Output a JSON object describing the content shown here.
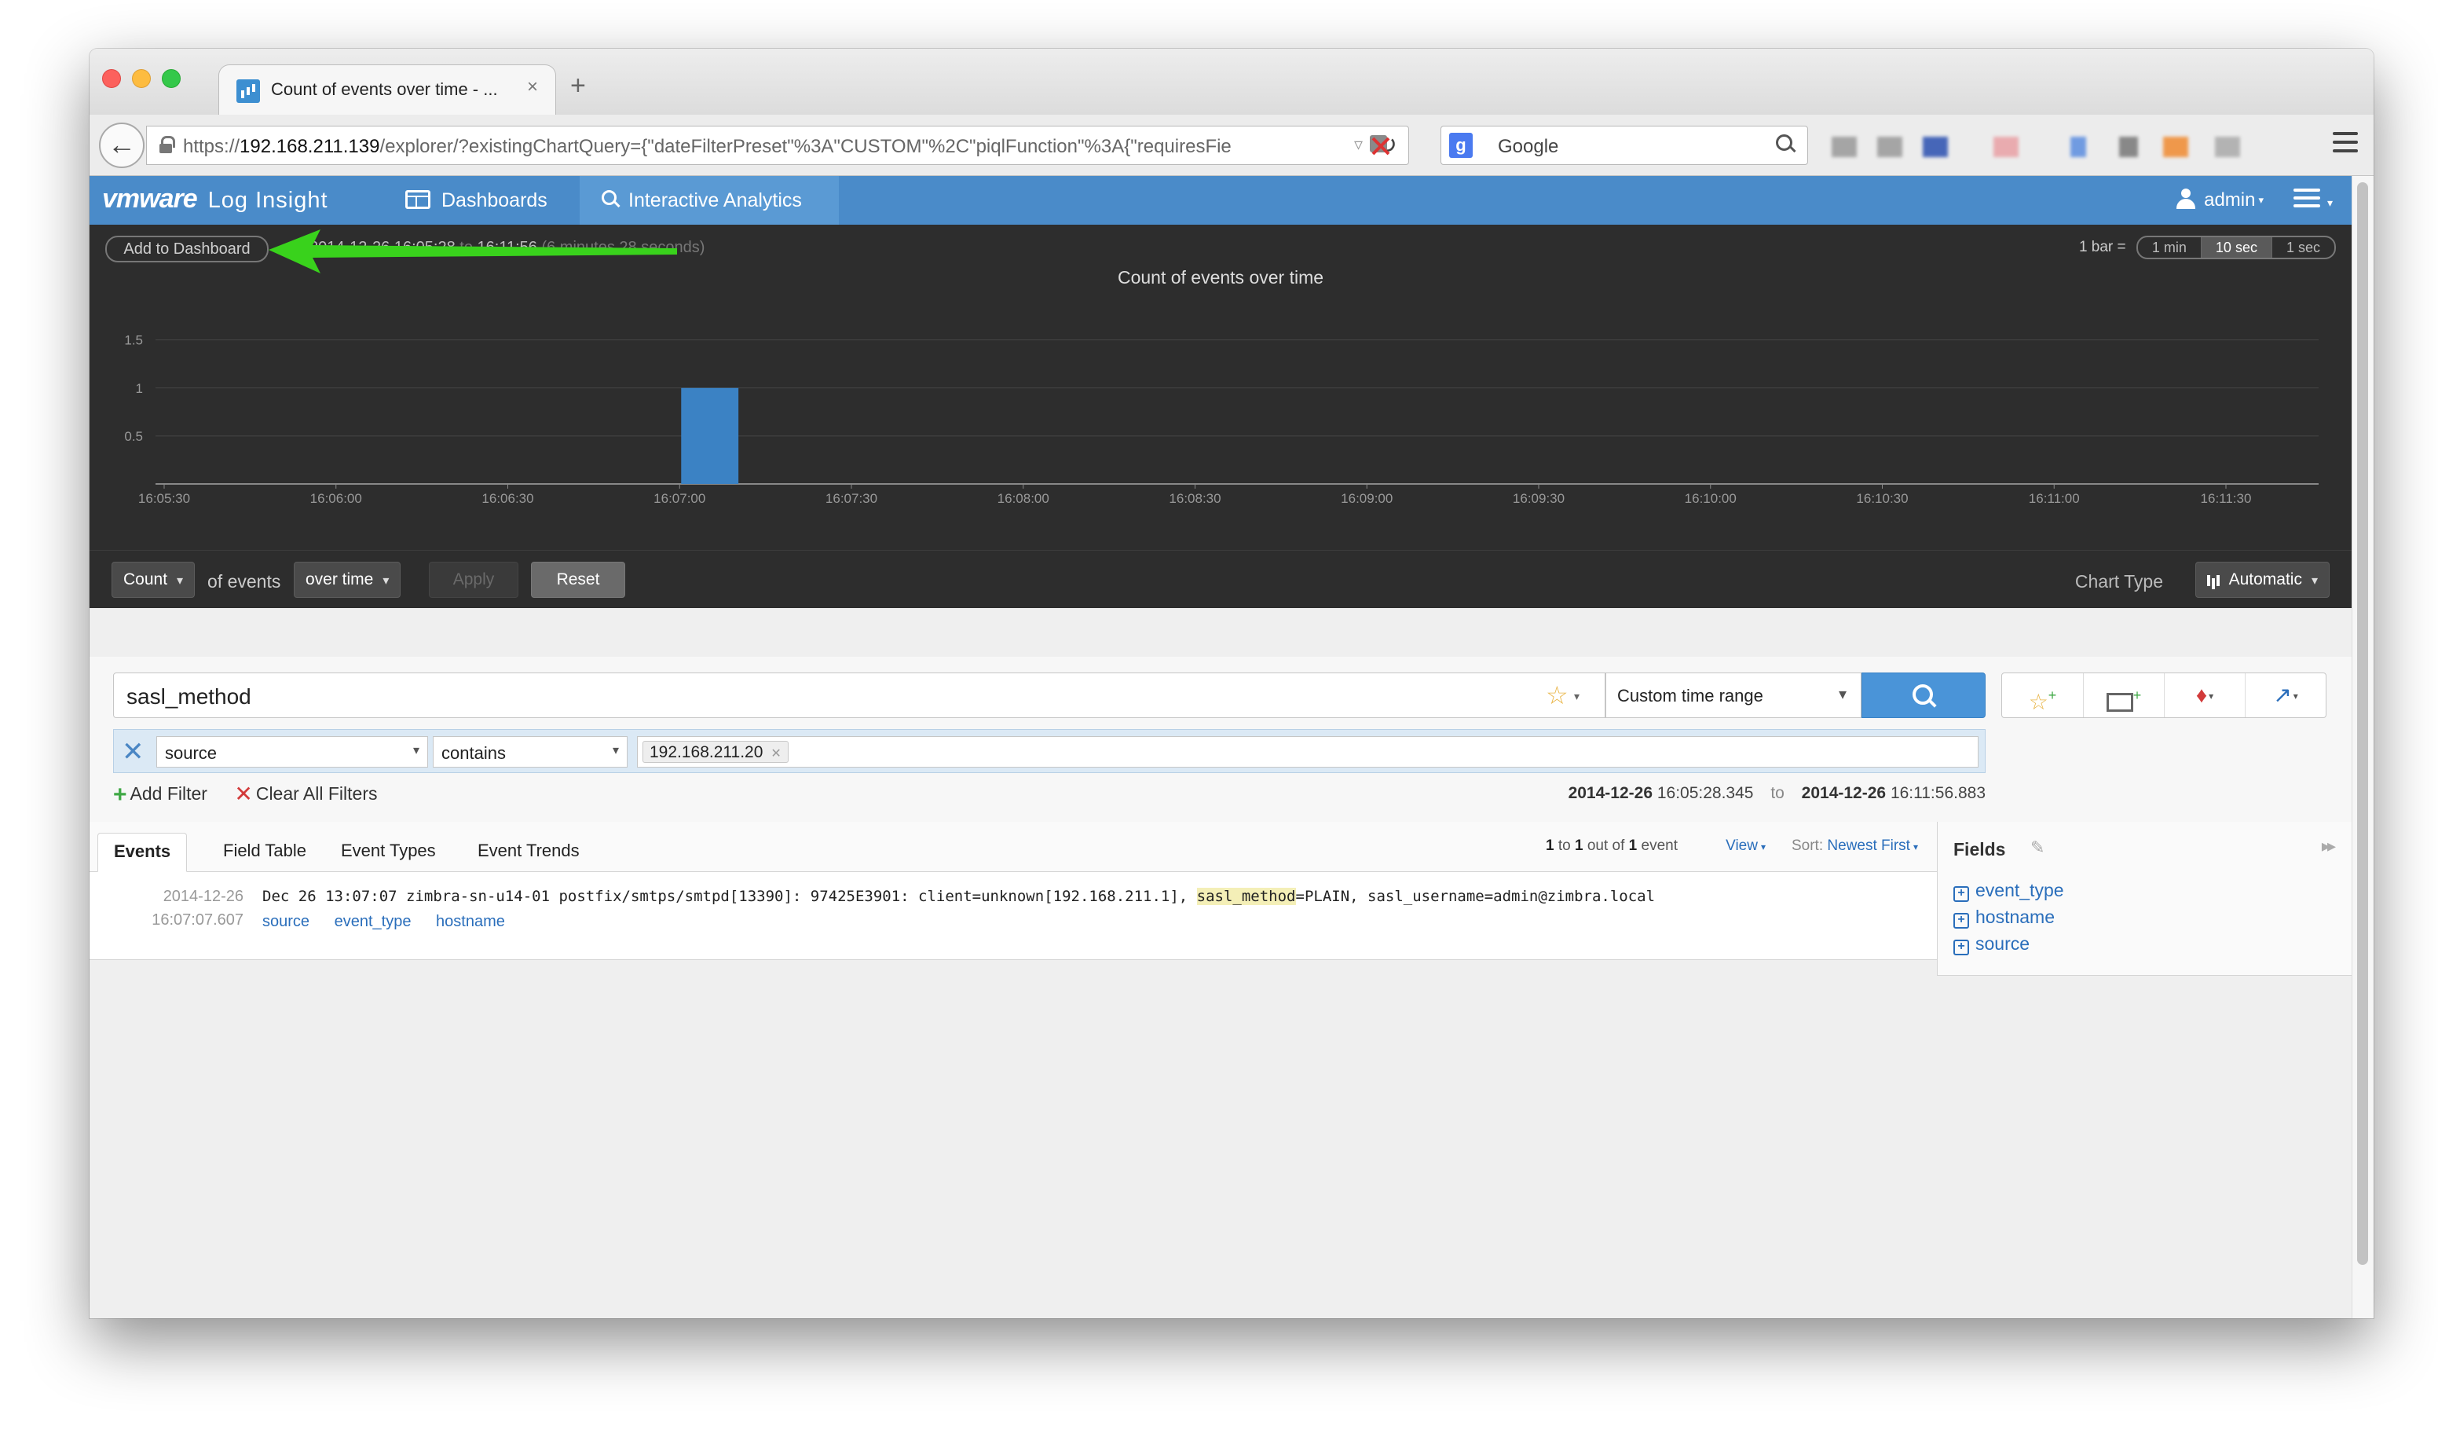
{
  "browser": {
    "tab_title": "Count of events over time - ...",
    "tab_close": "×",
    "new_tab": "+",
    "url_prefix": "https://",
    "url_host": "192.168.211.139",
    "url_rest": "/explorer/?existingChartQuery={\"dateFilterPreset\"%3A\"CUSTOM\"%2C\"piqlFunction\"%3A{\"requiresFie",
    "search_engine_label": "Google",
    "icons": [
      "back-arrow-icon",
      "lock-icon",
      "reload-icon",
      "addon-icon",
      "google-icon",
      "search-icon",
      "menu-icon"
    ]
  },
  "app": {
    "brand_vm": "vmware",
    "brand_product": "Log Insight",
    "nav": {
      "dashboards": "Dashboards",
      "interactive_analytics": "Interactive Analytics"
    },
    "user": "admin",
    "accent_color": "#4a8bc9"
  },
  "chart_header": {
    "add_to_dashboard": "Add to Dashboard",
    "range_start": "2014-12-26  16:05:28",
    "range_to": "to",
    "range_end": "16:11:56",
    "range_duration": "(6 minutes 28 seconds)",
    "bar_label": "1 bar =",
    "resolutions": [
      {
        "label": "1 min",
        "active": false
      },
      {
        "label": "10 sec",
        "active": true
      },
      {
        "label": "1 sec",
        "active": false
      }
    ]
  },
  "chart_data": {
    "type": "bar",
    "title": "Count of events over time",
    "xlabel": "",
    "ylabel": "",
    "yticks": [
      "0.5",
      "1",
      "1.5"
    ],
    "ylim": [
      0,
      1.8
    ],
    "xticks": [
      "16:05:30",
      "16:06:00",
      "16:06:30",
      "16:07:00",
      "16:07:30",
      "16:08:00",
      "16:08:30",
      "16:09:00",
      "16:09:30",
      "16:10:00",
      "16:10:30",
      "16:11:00",
      "16:11:30"
    ],
    "bars": [
      {
        "start": "16:07:00",
        "end": "16:07:10",
        "value": 1
      }
    ],
    "bar_color": "#3b82c4",
    "grid": true
  },
  "chart_controls": {
    "function": "Count",
    "of_events": "of events",
    "grouping": "over time",
    "apply": "Apply",
    "reset": "Reset",
    "chart_type_label": "Chart Type",
    "chart_type_value": "Automatic"
  },
  "query": {
    "text": "sasl_method",
    "time_range": "Custom time range",
    "filter": {
      "field": "source",
      "operator": "contains",
      "value": "192.168.211.20"
    },
    "add_filter": "Add Filter",
    "clear_filters": "Clear All Filters",
    "date_from": "2014-12-26",
    "time_from": "16:05:28.345",
    "date_to_label": "to",
    "date_to": "2014-12-26",
    "time_to": "16:11:56.883"
  },
  "results": {
    "tabs": [
      "Events",
      "Field Table",
      "Event Types",
      "Event Trends"
    ],
    "active_tab": "Events",
    "paging_from": "1",
    "paging_to_word": "to",
    "paging_to": "1",
    "paging_outof": "out of",
    "paging_total": "1",
    "paging_event": "event",
    "view": "View",
    "sort_label": "Sort:",
    "sort_value": "Newest First",
    "event": {
      "date": "2014-12-26",
      "time": "16:07:07.607",
      "text_before": "Dec 26 13:07:07 zimbra-sn-u14-01 postfix/smtps/smtpd[13390]: 97425E3901: client=unknown[192.168.211.1], ",
      "text_highlight": "sasl_method",
      "text_after": "=PLAIN, sasl_username=admin@zimbra.local",
      "fields": [
        "source",
        "event_type",
        "hostname"
      ]
    }
  },
  "fields_panel": {
    "title": "Fields",
    "items": [
      "event_type",
      "hostname",
      "source"
    ]
  }
}
